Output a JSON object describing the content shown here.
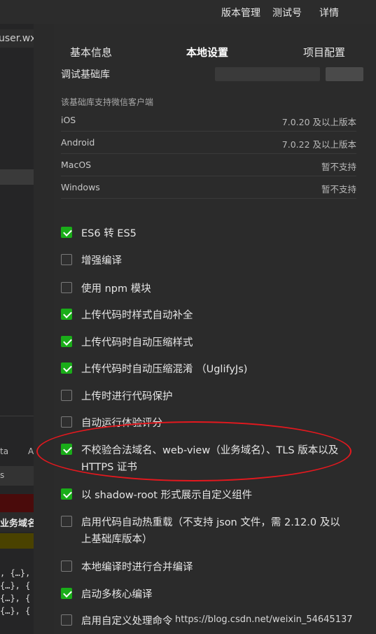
{
  "topbar": {
    "version_mgmt": "版本管理",
    "test_id": "测试号",
    "details": "详情"
  },
  "editor": {
    "tab_fragment": "user.wx",
    "frag_a": "ta",
    "frag_b": "A",
    "frag_s": "s",
    "frag_domain": "业务域名",
    "code_lines": [
      ", {…},",
      "{…}, {",
      "{…}, {",
      "{…}, {"
    ]
  },
  "tabs": {
    "basic": "基本信息",
    "local": "本地设置",
    "project": "项目配置"
  },
  "base_lib": {
    "label": "调试基础库",
    "support_head": "该基础库支持微信客户端",
    "platforms": [
      {
        "name": "iOS",
        "value": "7.0.20 及以上版本"
      },
      {
        "name": "Android",
        "value": "7.0.22 及以上版本"
      },
      {
        "name": "MacOS",
        "value": "暂不支持"
      },
      {
        "name": "Windows",
        "value": "暂不支持"
      }
    ]
  },
  "options": [
    {
      "label": "ES6 转 ES5",
      "checked": true
    },
    {
      "label": "增强编译",
      "checked": false
    },
    {
      "label": "使用 npm 模块",
      "checked": false
    },
    {
      "label": "上传代码时样式自动补全",
      "checked": true
    },
    {
      "label": "上传代码时自动压缩样式",
      "checked": true
    },
    {
      "label": "上传代码时自动压缩混淆 （UglifyJs)",
      "checked": true
    },
    {
      "label": "上传时进行代码保护",
      "checked": false
    },
    {
      "label": "自动运行体验评分",
      "checked": false
    },
    {
      "label": "不校验合法域名、web-view（业务域名）、TLS 版本以及 HTTPS 证书",
      "checked": true
    },
    {
      "label": "以 shadow-root 形式展示自定义组件",
      "checked": true
    },
    {
      "label": "启用代码自动热重载（不支持 json 文件，需 2.12.0 及以上基础库版本）",
      "checked": false
    },
    {
      "label": "本地编译时进行合并编译",
      "checked": false
    },
    {
      "label": "启动多核心编译",
      "checked": true
    },
    {
      "label": "启用自定义处理命令",
      "checked": false
    }
  ],
  "watermark": "https://blog.csdn.net/weixin_54645137",
  "colors": {
    "checkbox_checked": "#1aad19",
    "highlight_ellipse": "#e5181e",
    "background": "#2b2b2b"
  }
}
